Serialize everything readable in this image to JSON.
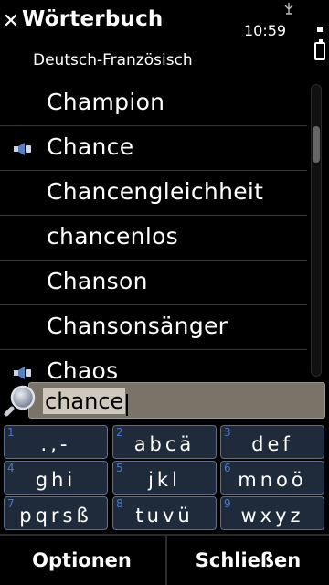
{
  "header": {
    "close_icon": "close-icon",
    "title": "Wörterbuch",
    "time": "10:59",
    "subtitle": "Deutsch-Französisch"
  },
  "list": {
    "items": [
      {
        "word": "Champion",
        "speaker": false
      },
      {
        "word": "Chance",
        "speaker": true
      },
      {
        "word": "Chancengleichheit",
        "speaker": false
      },
      {
        "word": "chancenlos",
        "speaker": false
      },
      {
        "word": "Chanson",
        "speaker": false
      },
      {
        "word": "Chansonsänger",
        "speaker": false
      },
      {
        "word": "Chaos",
        "speaker": true
      }
    ]
  },
  "search": {
    "value": "chance",
    "icon": "search-icon"
  },
  "keypad": {
    "keys": [
      {
        "num": "1",
        "letters": ".,-"
      },
      {
        "num": "2",
        "letters": "abcä"
      },
      {
        "num": "3",
        "letters": "def"
      },
      {
        "num": "4",
        "letters": "ghi"
      },
      {
        "num": "5",
        "letters": "jkl"
      },
      {
        "num": "6",
        "letters": "mnoö"
      },
      {
        "num": "7",
        "letters": "pqrsß"
      },
      {
        "num": "8",
        "letters": "tuvü"
      },
      {
        "num": "9",
        "letters": "wxyz"
      }
    ]
  },
  "softkeys": {
    "left": "Optionen",
    "right": "Schließen"
  },
  "colors": {
    "background": "#000000",
    "key_fill": "#1f2a3a",
    "key_border": "#5d6f8a",
    "key_number": "#4a78c8",
    "search_field": "#7a7468"
  }
}
